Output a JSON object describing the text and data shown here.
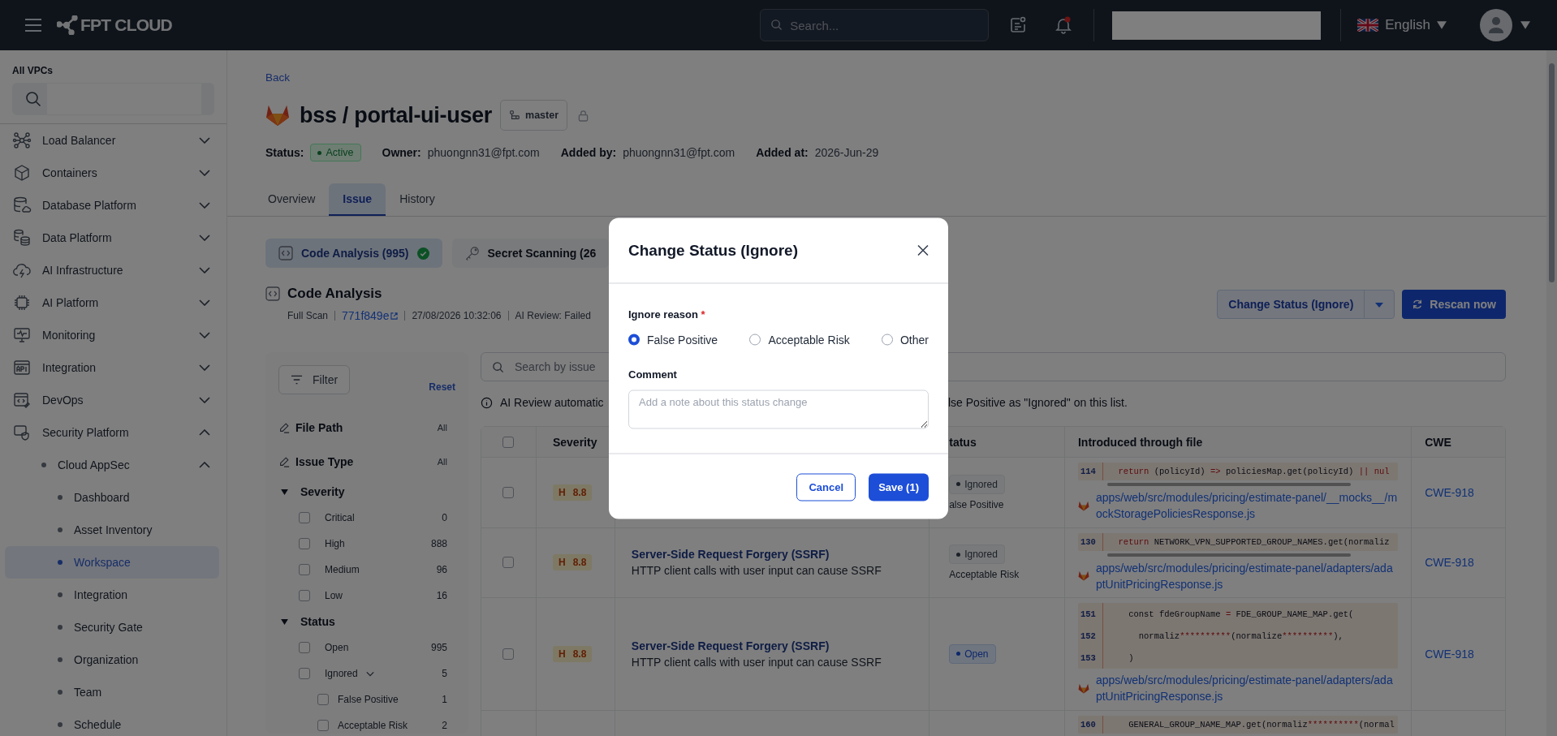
{
  "topbar": {
    "logo": "FPT CLOUD",
    "search": {
      "placeholder": "Search..."
    },
    "language": "English"
  },
  "sidebar": {
    "vpc_label": "All VPCs",
    "items": [
      {
        "label": "Load Balancer",
        "expanded": false
      },
      {
        "label": "Containers",
        "expanded": false
      },
      {
        "label": "Database Platform",
        "expanded": false
      },
      {
        "label": "Data Platform",
        "expanded": false
      },
      {
        "label": "AI Infrastructure",
        "expanded": false
      },
      {
        "label": "AI Platform",
        "expanded": false
      },
      {
        "label": "Monitoring",
        "expanded": false
      },
      {
        "label": "Integration",
        "expanded": false
      },
      {
        "label": "DevOps",
        "expanded": false
      },
      {
        "label": "Security Platform",
        "expanded": true,
        "children": [
          {
            "label": "Cloud AppSec",
            "expanded": true,
            "children": [
              {
                "label": "Dashboard",
                "selected": false
              },
              {
                "label": "Asset Inventory",
                "selected": false
              },
              {
                "label": "Workspace",
                "selected": true
              },
              {
                "label": "Integration",
                "selected": false
              },
              {
                "label": "Security Gate",
                "selected": false
              },
              {
                "label": "Organization",
                "selected": false
              },
              {
                "label": "Team",
                "selected": false
              },
              {
                "label": "Schedule",
                "selected": false
              }
            ]
          }
        ]
      }
    ]
  },
  "page": {
    "back": "Back",
    "title": "bss / portal-ui-user",
    "branch": "master",
    "meta": [
      {
        "label": "Status:",
        "value": "Active",
        "kind": "badge"
      },
      {
        "label": "Owner:",
        "value": "phuongnn31@fpt.com",
        "kind": "text"
      },
      {
        "label": "Added by:",
        "value": "phuongnn31@fpt.com",
        "kind": "text"
      },
      {
        "label": "Added at:",
        "value": "2026-Jun-29",
        "kind": "text"
      }
    ]
  },
  "tabs": [
    {
      "label": "Overview",
      "selected": false
    },
    {
      "label": "Issue",
      "selected": true
    },
    {
      "label": "History",
      "selected": false
    }
  ],
  "scan_tabs": [
    {
      "label": "Code Analysis (995)",
      "selected": true,
      "done": true
    },
    {
      "label": "Secret Scanning (26",
      "selected": false
    }
  ],
  "section": {
    "title": "Code Analysis",
    "scan_type": "Full Scan",
    "commit": "771f849e",
    "date": "27/08/2026 10:32:06",
    "ai_review": "AI Review: Failed",
    "change_status": "Change Status (Ignore)",
    "rescan": "Rescan now"
  },
  "filter": {
    "button": "Filter",
    "reset": "Reset",
    "fields": [
      {
        "label": "File Path",
        "value": "All"
      },
      {
        "label": "Issue Type",
        "value": "All"
      }
    ],
    "groups": [
      {
        "label": "Severity",
        "expanded": true,
        "options": [
          {
            "label": "Critical",
            "count": "0",
            "checked": false
          },
          {
            "label": "High",
            "count": "888",
            "checked": false
          },
          {
            "label": "Medium",
            "count": "96",
            "checked": false
          },
          {
            "label": "Low",
            "count": "16",
            "checked": false
          }
        ]
      },
      {
        "label": "Status",
        "expanded": true,
        "options": [
          {
            "label": "Open",
            "count": "995",
            "checked": false
          },
          {
            "label": "Ignored",
            "count": "5",
            "checked": false,
            "expanded": true,
            "children": [
              {
                "label": "False Positive",
                "count": "1",
                "checked": false
              },
              {
                "label": "Acceptable Risk",
                "count": "2",
                "checked": false
              }
            ]
          }
        ]
      }
    ]
  },
  "search": {
    "placeholder": "Search by issue"
  },
  "notice": {
    "left": "AI Review automatic",
    "right": "lse Positive as \"Ignored\" on this list."
  },
  "table": {
    "headers": {
      "severity": "Severity",
      "status": "tatus",
      "file": "Introduced through file",
      "cwe": "CWE"
    },
    "all_checked": false,
    "rows": [
      {
        "checked": false,
        "severity": {
          "kind": "high",
          "letter": "H",
          "score": "8.8"
        },
        "status": {
          "label": "Ignored",
          "kind": "ignored"
        },
        "reason": "alse Positive",
        "code": [
          {
            "num": "114",
            "parts": [
              {
                "text": "  return",
                "kind": "op"
              },
              {
                "text": " (policyId) ",
                "kind": "plain"
              },
              {
                "text": "=>",
                "kind": "op"
              },
              {
                "text": " policiesMap.get(policyId) ",
                "kind": "plain"
              },
              {
                "text": "||",
                "kind": "op"
              },
              {
                "text": " nul",
                "kind": "op"
              }
            ]
          }
        ],
        "code_scroll": true,
        "file": "apps/web/src/modules/pricing/estimate-panel/__mocks__/mockStoragePoliciesResponse.js",
        "cwe": "CWE-918"
      },
      {
        "checked": false,
        "severity": {
          "kind": "high",
          "letter": "H",
          "score": "8.8"
        },
        "title": "Server-Side Request Forgery (SSRF)",
        "description": "HTTP client calls with user input can cause SSRF",
        "status": {
          "label": "Ignored",
          "kind": "ignored"
        },
        "reason": "Acceptable Risk",
        "code": [
          {
            "num": "130",
            "parts": [
              {
                "text": "  return",
                "kind": "op"
              },
              {
                "text": " NETWORK_VPN_SUPPORTED_GROUP_NAMES.get(normaliz",
                "kind": "plain"
              }
            ]
          }
        ],
        "code_scroll": true,
        "file": "apps/web/src/modules/pricing/estimate-panel/adapters/adaptUnitPricingResponse.js",
        "cwe": "CWE-918"
      },
      {
        "checked": false,
        "severity": {
          "kind": "high",
          "letter": "H",
          "score": "8.8"
        },
        "title": "Server-Side Request Forgery (SSRF)",
        "description": "HTTP client calls with user input can cause SSRF",
        "status": {
          "label": "Open",
          "kind": "open"
        },
        "code": [
          {
            "num": "151",
            "parts": [
              {
                "text": "    const fdeGroupName ",
                "kind": "plain"
              },
              {
                "text": "=",
                "kind": "op"
              },
              {
                "text": " FDE_GROUP_NAME_MAP.get(",
                "kind": "plain"
              }
            ]
          },
          {
            "num": "152",
            "parts": [
              {
                "text": "      normaliz",
                "kind": "plain"
              },
              {
                "text": "**********",
                "kind": "op"
              },
              {
                "text": "(normalize",
                "kind": "plain"
              },
              {
                "text": "**********",
                "kind": "op"
              },
              {
                "text": "),",
                "kind": "plain"
              }
            ]
          },
          {
            "num": "153",
            "parts": [
              {
                "text": "    )",
                "kind": "plain"
              }
            ]
          }
        ],
        "code_scroll": false,
        "file": "apps/web/src/modules/pricing/estimate-panel/adapters/adaptUnitPricingResponse.js",
        "cwe": "CWE-918"
      },
      {
        "code": [
          {
            "num": "160",
            "parts": [
              {
                "text": "    GENERAL_GROUP_NAME_MAP.get(normaliz",
                "kind": "plain"
              },
              {
                "text": "**********",
                "kind": "op"
              },
              {
                "text": "(normal",
                "kind": "plain"
              }
            ]
          }
        ],
        "code_scroll": false
      }
    ]
  },
  "modal": {
    "title": "Change Status (Ignore)",
    "reason_label": "Ignore reason",
    "required_mark": "*",
    "options": [
      {
        "label": "False Positive",
        "selected": true
      },
      {
        "label": "Acceptable Risk",
        "selected": false
      },
      {
        "label": "Other",
        "selected": false
      }
    ],
    "comment_label": "Comment",
    "comment_placeholder": "Add a note about this status change",
    "cancel": "Cancel",
    "save": "Save (1)"
  }
}
